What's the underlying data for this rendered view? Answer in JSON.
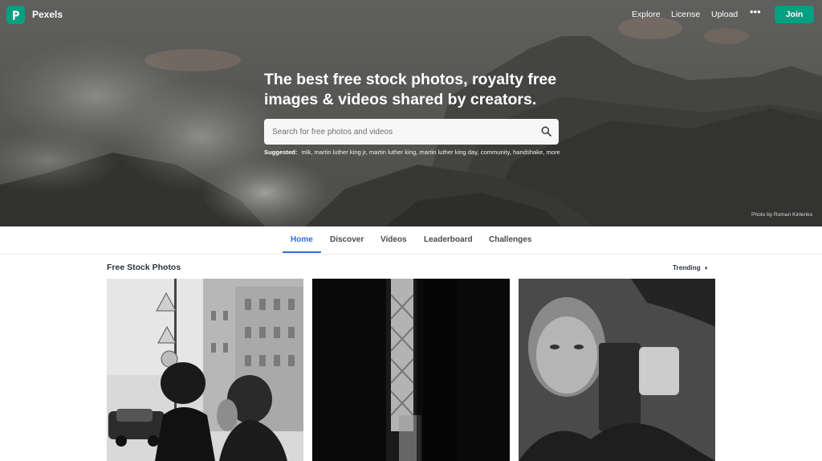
{
  "brand": {
    "name": "Pexels",
    "logo_icon": "pexels-logo-icon",
    "accent": "#05a081"
  },
  "nav": {
    "links": [
      "Explore",
      "License",
      "Upload"
    ],
    "more_icon": "more-dots-icon",
    "more_label": "•••",
    "join_label": "Join"
  },
  "hero": {
    "headline": "The best free stock photos, royalty free images & videos shared by creators.",
    "search": {
      "placeholder": "Search for free photos and videos",
      "value": "",
      "icon": "search-icon"
    },
    "suggested_label": "Suggested:",
    "suggested": [
      "mlk",
      "martin luther king jr",
      "martin luther king",
      "martin luther king day",
      "community",
      "handshake",
      "more"
    ],
    "credit": "Photo by Roman Kirilenko"
  },
  "tabs": {
    "items": [
      "Home",
      "Discover",
      "Videos",
      "Leaderboard",
      "Challenges"
    ],
    "active": "Home",
    "active_color": "#2a6fdb"
  },
  "feed": {
    "title": "Free Stock Photos",
    "sort_label": "Trending",
    "sort_icon": "caret-down-icon"
  }
}
